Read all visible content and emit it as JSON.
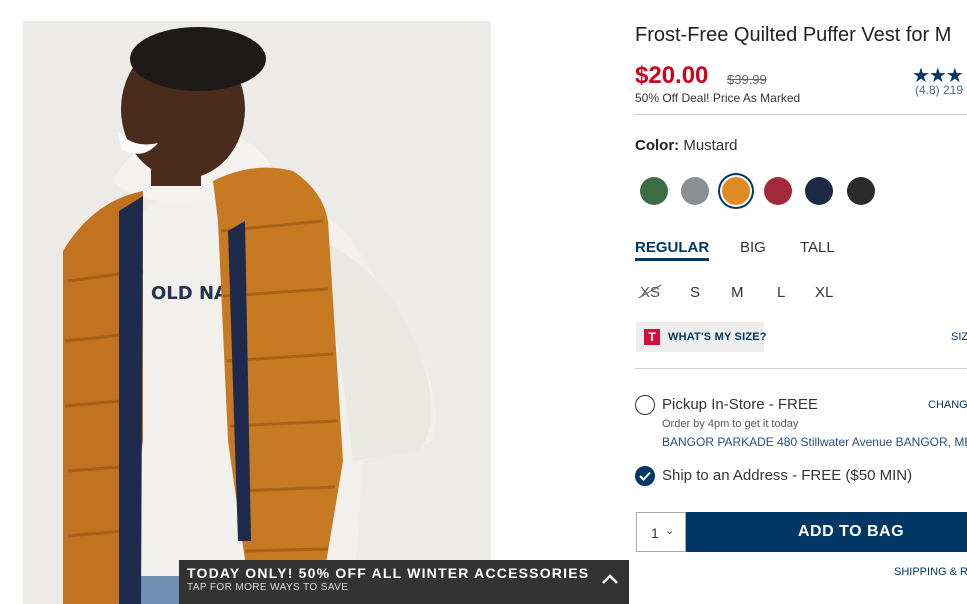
{
  "product": {
    "title": "Frost-Free Quilted Puffer Vest for M",
    "price": "$20.00",
    "original_price": "$39.99",
    "deal_text": "50% Off Deal! Price As Marked",
    "rating_stars": "★★★",
    "reviews": "(4.8) 219",
    "image_logo_text": "OLD NAVY"
  },
  "color": {
    "label": "Color:",
    "value": "Mustard",
    "swatches": [
      {
        "name": "green",
        "hex": "#3f6b45"
      },
      {
        "name": "gray",
        "hex": "#8a8f93"
      },
      {
        "name": "mustard",
        "hex": "#e08a25"
      },
      {
        "name": "red",
        "hex": "#a32a3a"
      },
      {
        "name": "navy",
        "hex": "#1c2a45"
      },
      {
        "name": "black",
        "hex": "#2b2b2b"
      }
    ]
  },
  "fits": [
    "REGULAR",
    "BIG",
    "TALL"
  ],
  "sizes": [
    "XS",
    "S",
    "M",
    "L",
    "XL"
  ],
  "whats_my_size": {
    "icon": "T",
    "label": "WHAT'S MY SIZE?"
  },
  "size_chart": "SIZ",
  "pickup": {
    "label": "Pickup In-Store - FREE",
    "note": "Order by 4pm to get it today",
    "store": "BANGOR PARKADE 480 Stillwater Avenue  BANGOR, ME",
    "change": "CHANG"
  },
  "ship": {
    "label": "Ship to an Address - FREE ($50 MIN)"
  },
  "cart": {
    "qty": "1",
    "add_label": "ADD TO BAG"
  },
  "shipping_link": "SHIPPING & R",
  "promo": {
    "title": "TODAY ONLY! 50% OFF ALL WINTER ACCESSORIES",
    "subtitle": "TAP FOR MORE WAYS TO SAVE"
  }
}
